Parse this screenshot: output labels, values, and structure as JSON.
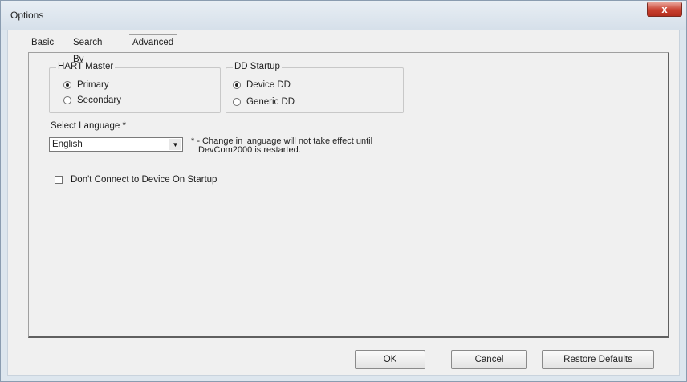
{
  "window": {
    "title": "Options",
    "close_glyph": "x"
  },
  "tabs": [
    {
      "label": "Basic"
    },
    {
      "label": "Search By"
    },
    {
      "label": "Advanced"
    }
  ],
  "hart_master": {
    "legend": "HART Master",
    "options": [
      {
        "label": "Primary",
        "selected": true
      },
      {
        "label": "Secondary",
        "selected": false
      }
    ]
  },
  "dd_startup": {
    "legend": "DD Startup",
    "options": [
      {
        "label": "Device DD",
        "selected": true
      },
      {
        "label": "Generic DD",
        "selected": false
      }
    ]
  },
  "language": {
    "label": "Select Language *",
    "value": "English",
    "note_line1": "* - Change in language will not take effect until",
    "note_line2": "DevCom2000 is restarted."
  },
  "startup_checkbox": {
    "label": "Don't Connect to Device On Startup",
    "checked": false
  },
  "buttons": {
    "ok": "OK",
    "cancel": "Cancel",
    "restore": "Restore Defaults"
  }
}
